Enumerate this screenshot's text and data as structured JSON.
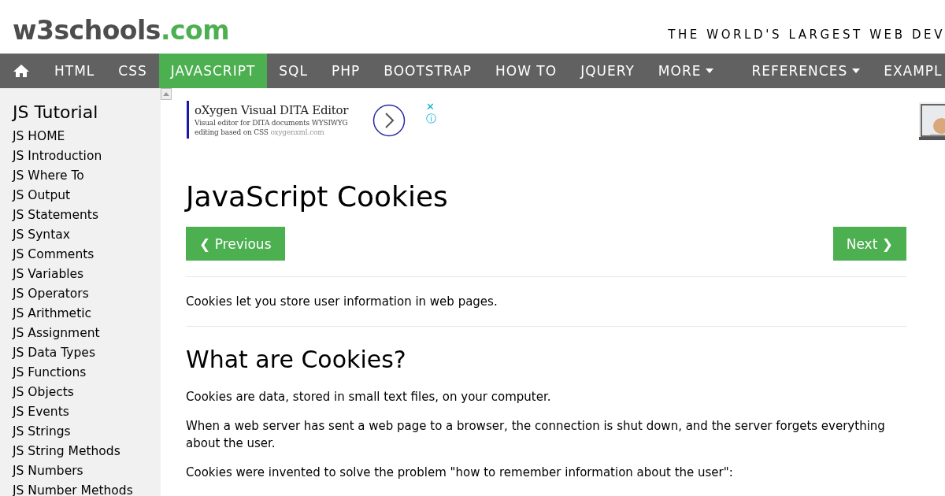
{
  "header": {
    "logo_main": "w3schools",
    "logo_suffix": ".com",
    "tagline": "THE WORLD'S LARGEST WEB DEV"
  },
  "nav": [
    {
      "kind": "home",
      "selected": false
    },
    {
      "kind": "link",
      "label": "HTML",
      "selected": false
    },
    {
      "kind": "link",
      "label": "CSS",
      "selected": false
    },
    {
      "kind": "link",
      "label": "JAVASCRIPT",
      "selected": true
    },
    {
      "kind": "link",
      "label": "SQL",
      "selected": false
    },
    {
      "kind": "link",
      "label": "PHP",
      "selected": false
    },
    {
      "kind": "link",
      "label": "BOOTSTRAP",
      "selected": false
    },
    {
      "kind": "link",
      "label": "HOW TO",
      "selected": false
    },
    {
      "kind": "link",
      "label": "JQUERY",
      "selected": false
    },
    {
      "kind": "dropdown",
      "label": "MORE",
      "selected": false
    },
    {
      "kind": "dropdown",
      "label": "REFERENCES",
      "selected": false
    },
    {
      "kind": "link",
      "label": "EXAMPL",
      "selected": false
    }
  ],
  "sidebar": {
    "title": "JS Tutorial",
    "items": [
      "JS HOME",
      "JS Introduction",
      "JS Where To",
      "JS Output",
      "JS Statements",
      "JS Syntax",
      "JS Comments",
      "JS Variables",
      "JS Operators",
      "JS Arithmetic",
      "JS Assignment",
      "JS Data Types",
      "JS Functions",
      "JS Objects",
      "JS Events",
      "JS Strings",
      "JS String Methods",
      "JS Numbers",
      "JS Number Methods"
    ]
  },
  "ad": {
    "title": "oXygen Visual DITA Editor",
    "text": "Visual editor for DITA documents WYSIWYG editing based on CSS",
    "domain": "oxygenxml.com",
    "close": "✕",
    "info": "ⓘ"
  },
  "main": {
    "title": "JavaScript Cookies",
    "previous": "❮ Previous",
    "next": "Next ❯",
    "blocks": [
      {
        "kind": "hr"
      },
      {
        "kind": "p",
        "text": "Cookies let you store user information in web pages."
      },
      {
        "kind": "hr"
      },
      {
        "kind": "h2",
        "text": "What are Cookies?"
      },
      {
        "kind": "p",
        "text": "Cookies are data, stored in small text files, on your computer."
      },
      {
        "kind": "p",
        "text": "When a web server has sent a web page to a browser, the connection is shut down, and the server forgets everything about the user."
      },
      {
        "kind": "p",
        "text": "Cookies were invented to solve the problem \"how to remember information about the user\":"
      }
    ]
  }
}
